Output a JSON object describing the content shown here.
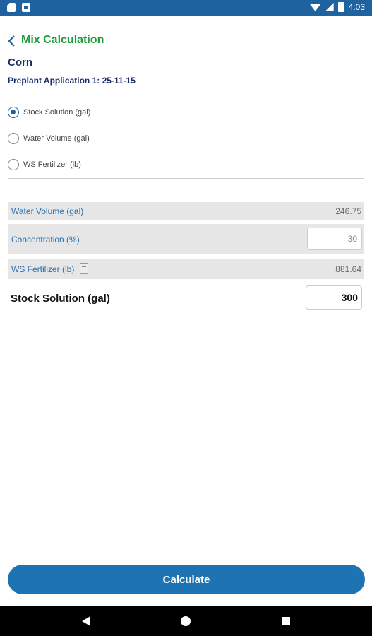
{
  "status_bar": {
    "time": "4:03"
  },
  "header": {
    "title": "Mix Calculation"
  },
  "crop": "Corn",
  "application": "Preplant Application 1: 25-11-15",
  "calc_options": [
    {
      "label": "Stock Solution (gal)",
      "selected": true
    },
    {
      "label": "Water Volume (gal)",
      "selected": false
    },
    {
      "label": "WS Fertilizer (lb)",
      "selected": false
    }
  ],
  "fields": {
    "water_volume": {
      "label": "Water Volume (gal)",
      "value": "246.75"
    },
    "concentration": {
      "label": "Concentration (%)",
      "value": "30"
    },
    "ws_fertilizer": {
      "label": "WS Fertilizer (lb)",
      "value": "881.64"
    },
    "stock_solution": {
      "label": "Stock Solution (gal)",
      "value": "300"
    }
  },
  "calculate_label": "Calculate",
  "colors": {
    "primary": "#1e63a0",
    "accent_green": "#1e9d3c",
    "field_label": "#2a6fb0",
    "navy": "#1b2a68"
  }
}
